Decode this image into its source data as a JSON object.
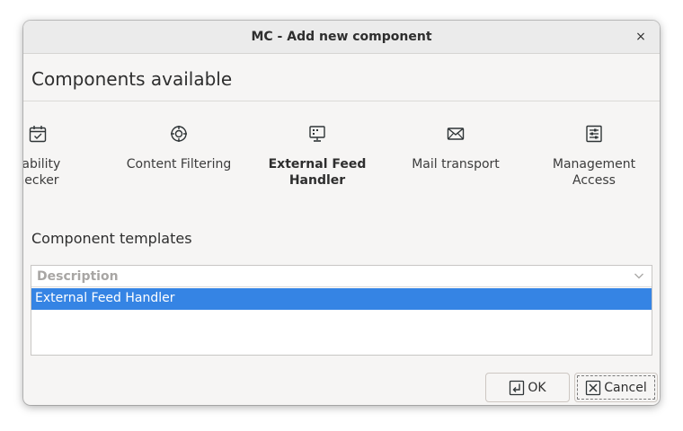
{
  "window": {
    "title": "MC - Add new component",
    "close_glyph": "×"
  },
  "components_section": {
    "title": "Components available",
    "items": [
      {
        "label_line1": "ilability",
        "label_line2": "necker",
        "icon": "calendar-check-icon"
      },
      {
        "label_line1": "Content Filtering",
        "label_line2": "",
        "icon": "crosshair-globe-icon"
      },
      {
        "label_line1": "External Feed",
        "label_line2": "Handler",
        "icon": "monitor-icon",
        "selected": true
      },
      {
        "label_line1": "Mail transport",
        "label_line2": "",
        "icon": "envelope-icon"
      },
      {
        "label_line1": "Management",
        "label_line2": "Access",
        "icon": "sliders-icon"
      }
    ]
  },
  "templates_section": {
    "title": "Component templates",
    "column_header": "Description",
    "rows": [
      "External Feed Handler"
    ]
  },
  "buttons": {
    "ok_label": "OK",
    "cancel_label": "Cancel"
  },
  "colors": {
    "accent": "#3584e4",
    "icon": "#2e3436"
  }
}
